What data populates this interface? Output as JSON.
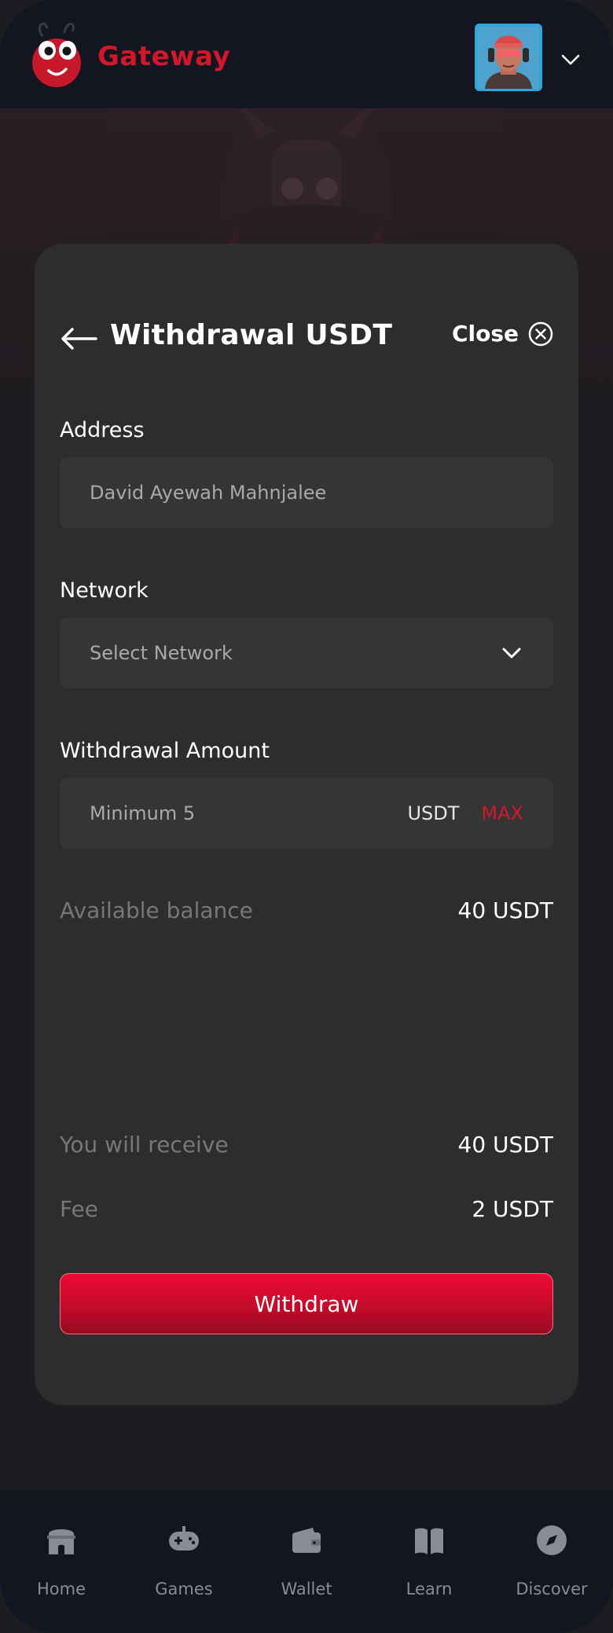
{
  "header": {
    "brand": "Gateway",
    "avatar_icon": "user-avatar",
    "menu_icon": "chevron-down-icon"
  },
  "withdraw": {
    "title": "Withdrawal USDT",
    "close_label": "Close",
    "address": {
      "label": "Address",
      "value": "David Ayewah Mahnjalee"
    },
    "network": {
      "label": "Network",
      "placeholder": "Select Network"
    },
    "amount": {
      "label": "Withdrawal Amount",
      "placeholder": "Minimum 5",
      "unit": "USDT",
      "max_label": "MAX"
    },
    "available_balance": {
      "label": "Available balance",
      "value": "40 USDT"
    },
    "receive": {
      "label": "You will receive",
      "value": "40 USDT"
    },
    "fee": {
      "label": "Fee",
      "value": "2 USDT"
    },
    "submit_label": "Withdraw"
  },
  "nav": {
    "items": [
      {
        "label": "Home",
        "icon": "home-icon"
      },
      {
        "label": "Games",
        "icon": "gamepad-icon"
      },
      {
        "label": "Wallet",
        "icon": "wallet-icon"
      },
      {
        "label": "Learn",
        "icon": "book-icon"
      },
      {
        "label": "Discover",
        "icon": "compass-icon"
      }
    ]
  },
  "colors": {
    "accent": "#d3172b",
    "background": "#1c1d21",
    "card": "#2d2d2d",
    "field": "#353535",
    "nav_bg": "#131620"
  }
}
